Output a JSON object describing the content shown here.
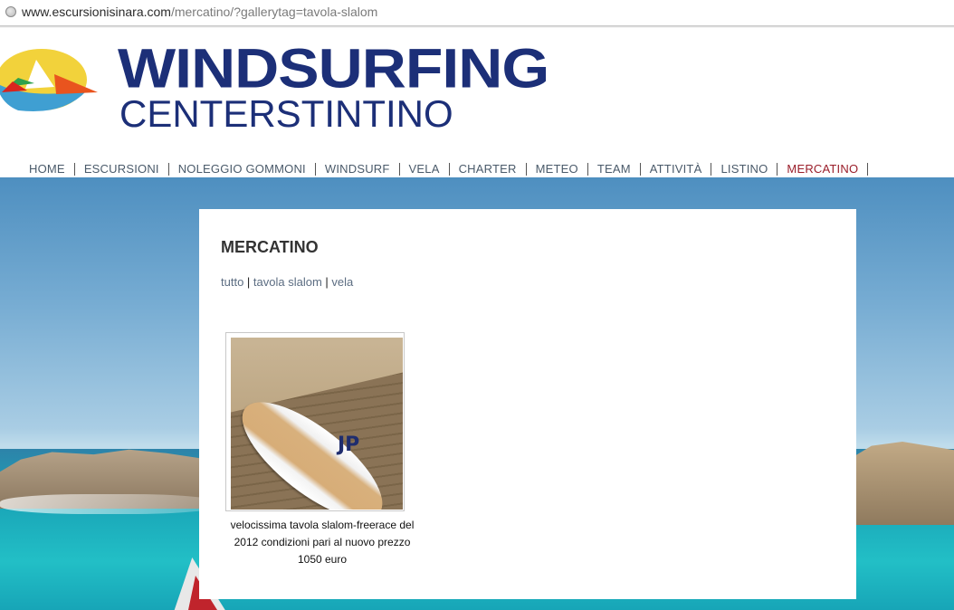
{
  "browser": {
    "url_domain": "www.escursionisinara.com",
    "url_path": "/mercatino/?gallerytag=tavola-slalom"
  },
  "header": {
    "brand_line1": "WINDSURFING",
    "brand_line2": "CENTERSTINTINO"
  },
  "nav": {
    "items": [
      "HOME",
      "ESCURSIONI",
      "NOLEGGIO GOMMONI",
      "WINDSURF",
      "VELA",
      "CHARTER",
      "METEO",
      "TEAM",
      "ATTIVITÀ",
      "LISTINO",
      "MERCATINO"
    ],
    "active": "MERCATINO"
  },
  "page": {
    "title": "MERCATINO",
    "filters": [
      "tutto",
      "tavola slalom",
      "vela"
    ],
    "gallery": [
      {
        "image": "windsurf-board-photo",
        "caption": "velocissima tavola slalom-freerace del 2012 condizioni pari al nuovo prezzo 1050 euro",
        "board_logo": "JP"
      }
    ]
  },
  "colors": {
    "brand_blue": "#1c2f78",
    "nav_active": "#9a1e2a",
    "link": "#5c6d82"
  }
}
